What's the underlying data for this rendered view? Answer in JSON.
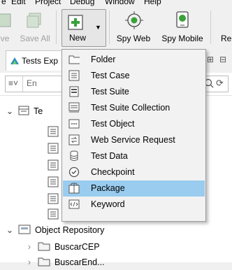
{
  "menubar": {
    "items": [
      "e",
      "Edit",
      "Project",
      "Debug",
      "Window",
      "Help"
    ]
  },
  "toolbar": {
    "save_label": "ve",
    "save_all_label": "Save All",
    "new_label": "New",
    "spy_web_label": "Spy Web",
    "spy_mobile_label": "Spy Mobile",
    "record_label": "Re"
  },
  "explorer": {
    "tab_label": "Tests Exp",
    "search_placeholder": "En"
  },
  "tree": {
    "root_label": "Te",
    "object_repository_label": "Object Repository",
    "child_1_label": "BuscarCEP",
    "child_2_label": "BuscarEnd..."
  },
  "new_menu": {
    "items": [
      {
        "label": "Folder",
        "icon": "folder-icon"
      },
      {
        "label": "Test Case",
        "icon": "test-case-icon"
      },
      {
        "label": "Test Suite",
        "icon": "test-suite-icon"
      },
      {
        "label": "Test Suite Collection",
        "icon": "test-suite-collection-icon"
      },
      {
        "label": "Test Object",
        "icon": "test-object-icon"
      },
      {
        "label": "Web Service Request",
        "icon": "web-service-request-icon"
      },
      {
        "label": "Test Data",
        "icon": "test-data-icon"
      },
      {
        "label": "Checkpoint",
        "icon": "checkpoint-icon"
      },
      {
        "label": "Package",
        "icon": "package-icon"
      },
      {
        "label": "Keyword",
        "icon": "keyword-icon"
      }
    ],
    "highlighted": "Package"
  },
  "colors": {
    "highlight": "#99ccef",
    "accent_green": "#3aa13a"
  }
}
